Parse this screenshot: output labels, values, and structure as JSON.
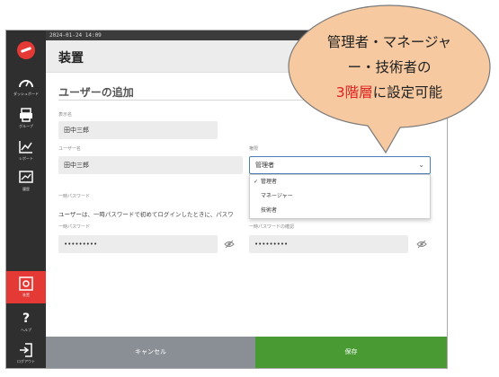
{
  "statusbar": {
    "datetime": "2024-01-24 14:09"
  },
  "sidebar": {
    "items": [
      {
        "label": "ダッシュボード",
        "icon": "gauge-icon"
      },
      {
        "label": "グループ",
        "icon": "printer-icon"
      },
      {
        "label": "レポート",
        "icon": "chart-icon"
      },
      {
        "label": "履歴",
        "icon": "history-icon"
      },
      {
        "label": "装置",
        "icon": "device-icon"
      },
      {
        "label": "ヘルプ",
        "icon": "help-icon",
        "glyph": "?"
      },
      {
        "label": "ログアウト",
        "icon": "logout-icon"
      }
    ],
    "active_color": "#e53935"
  },
  "header": {
    "title": "装置"
  },
  "form": {
    "subtitle": "ユーザーの追加",
    "display_name_label": "表示名",
    "display_name_value": "田中三郎",
    "username_label": "ユーザー名",
    "username_value": "田中三郎",
    "role_label": "権限",
    "role_value": "管理者",
    "role_options": [
      "管理者",
      "マネージャー",
      "技術者"
    ],
    "temp_password_section": "一時パスワード",
    "temp_password_hint": "ユーザーは、一時パスワードで初めてログインしたときに、パスワ",
    "temp_password_label": "一時パスワード",
    "temp_password_value": "•••••••••",
    "temp_password_confirm_label": "一時パスワードの確認",
    "temp_password_confirm_value": "•••••••••"
  },
  "footer": {
    "cancel_label": "キャンセル",
    "save_label": "保存"
  },
  "callout": {
    "line1": "管理者・マネージャ",
    "line2": "ー・技術者の",
    "line3_red": "3階層",
    "line3_rest": "に設定可能"
  },
  "colors": {
    "save": "#4a9a33",
    "cancel": "#8a8f96",
    "callout_fill": "#f6c9a0",
    "accent_red": "#e02020"
  }
}
